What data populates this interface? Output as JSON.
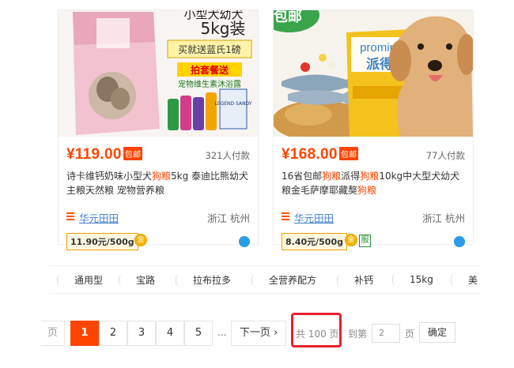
{
  "products": [
    {
      "image_alt": "诗卡维钙奶味小型犬狗粮5kg",
      "image_text_1": "小型犬幼犬",
      "image_text_2": "5kg装",
      "image_promo_1": "买就送蓝氏1磅",
      "image_promo_2": "拍套餐送",
      "image_promo_3": "宠物维生素沐浴露",
      "image_bag_text": "LEGEND SANDY",
      "price": "¥119.00",
      "badge": "包邮",
      "sold": "321人付款",
      "title_parts": [
        "诗卡维钙奶味小型犬",
        "狗粮",
        "5kg 泰迪比熊幼犬主粮天然粮 宠物营养粮"
      ],
      "shop": "华元田田",
      "location": "浙江 杭州",
      "unit_price": "11.90元/500g",
      "coin_text": "金"
    },
    {
      "image_alt": "派得狗粮10kg",
      "image_text_1": "包邮",
      "image_text_2": "promin",
      "image_text_3": "派得",
      "price": "¥168.00",
      "badge": "包邮",
      "sold": "77人付款",
      "title_parts": [
        "16省包邮",
        "狗粮",
        "派得",
        "狗粮",
        "10kg中大型犬幼犬粮金毛萨摩耶藏獒",
        "狗粮"
      ],
      "shop": "华元田田",
      "location": "浙江 杭州",
      "unit_price": "8.40元/500g",
      "coin_text": "金",
      "fu_text": "服"
    }
  ],
  "tags": [
    "通用型",
    "宝路",
    "拉布拉多",
    "全营养配方",
    "补钙",
    "15kg",
    "美"
  ],
  "pagination": {
    "prev_partial": "页",
    "pages": [
      "1",
      "2",
      "3",
      "4",
      "5"
    ],
    "ellipsis": "...",
    "next": "下一页",
    "next_arrow": "›",
    "total": "共 100 页,",
    "goto_label": "到第",
    "goto_value": "2",
    "page_unit": "页",
    "confirm": "确定"
  },
  "colors": {
    "accent": "#ff4400",
    "link": "#3d7cc9",
    "highlight": "#e8202a"
  }
}
